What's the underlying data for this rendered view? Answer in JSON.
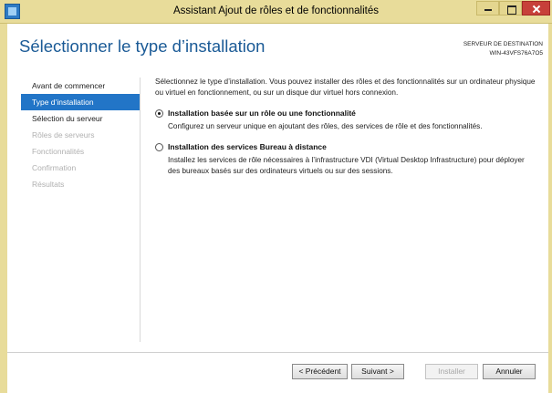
{
  "window": {
    "title": "Assistant Ajout de rôles et de fonctionnalités"
  },
  "header": {
    "page_title": "Sélectionner le type d’installation",
    "destination_label": "SERVEUR DE DESTINATION",
    "destination_server": "WIN-43VFS76A7O5"
  },
  "sidebar": {
    "items": [
      {
        "label": "Avant de commencer",
        "state": "normal"
      },
      {
        "label": "Type d’installation",
        "state": "active"
      },
      {
        "label": "Sélection du serveur",
        "state": "normal"
      },
      {
        "label": "Rôles de serveurs",
        "state": "disabled"
      },
      {
        "label": "Fonctionnalités",
        "state": "disabled"
      },
      {
        "label": "Confirmation",
        "state": "disabled"
      },
      {
        "label": "Résultats",
        "state": "disabled"
      }
    ]
  },
  "main": {
    "intro": "Sélectionnez le type d’installation. Vous pouvez installer des rôles et des fonctionnalités sur un ordinateur physique ou virtuel en fonctionnement, ou sur un disque dur virtuel hors connexion.",
    "options": [
      {
        "title": "Installation basée sur un rôle ou une fonctionnalité",
        "description": "Configurez un serveur unique en ajoutant des rôles, des services de rôle et des fonctionnalités.",
        "selected": true
      },
      {
        "title": "Installation des services Bureau à distance",
        "description": "Installez les services de rôle nécessaires à l’infrastructure VDI (Virtual Desktop Infrastructure) pour déployer des bureaux basés sur des ordinateurs virtuels ou sur des sessions.",
        "selected": false
      }
    ]
  },
  "footer": {
    "previous_label": "< Précédent",
    "next_label": "Suivant >",
    "install_label": "Installer",
    "cancel_label": "Annuler"
  },
  "colors": {
    "titlebar": "#e8dc9a",
    "accent": "#2275c7",
    "page_title": "#1a5a96",
    "close_button": "#c7403a"
  }
}
